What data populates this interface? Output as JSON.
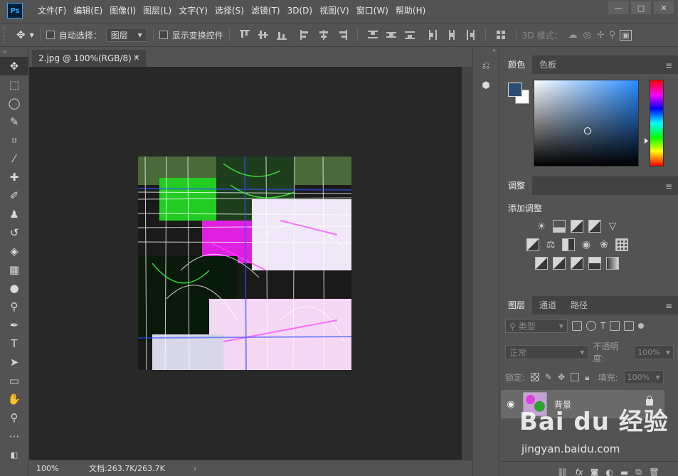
{
  "app": {
    "logo": "Ps"
  },
  "menu": [
    "文件(F)",
    "编辑(E)",
    "图像(I)",
    "图层(L)",
    "文字(Y)",
    "选择(S)",
    "滤镜(T)",
    "3D(D)",
    "视图(V)",
    "窗口(W)",
    "帮助(H)"
  ],
  "window_controls": [
    "—",
    "□",
    "✕"
  ],
  "options": {
    "auto_select_label": "自动选择：",
    "auto_select_value": "图层",
    "show_transform_label": "显示变换控件",
    "mode_3d_label": "3D 模式："
  },
  "document": {
    "tab_title": "2.jpg @ 100%(RGB/8) *",
    "tab_close": "×",
    "zoom": "100%",
    "doc_info": "文档:263.7K/263.7K",
    "info_arrow": "›"
  },
  "color_panel": {
    "tabs": [
      "颜色",
      "色板"
    ],
    "foreground": "#2c4d73",
    "background": "#ffffff"
  },
  "adjust_panel": {
    "tab": "调整",
    "title": "添加调整"
  },
  "layers_panel": {
    "tabs": [
      "图层",
      "通道",
      "路径"
    ],
    "filter_placeholder": "类型",
    "blend_mode": "正常",
    "opacity_label": "不透明度:",
    "opacity_value": "100%",
    "lock_label": "锁定:",
    "fill_label": "填充:",
    "fill_value": "100%",
    "layers": [
      {
        "name": "背景",
        "visible": true,
        "locked": true
      }
    ]
  },
  "watermark": {
    "main": "Bai du 经验",
    "sub": "jingyan.baidu.com"
  }
}
